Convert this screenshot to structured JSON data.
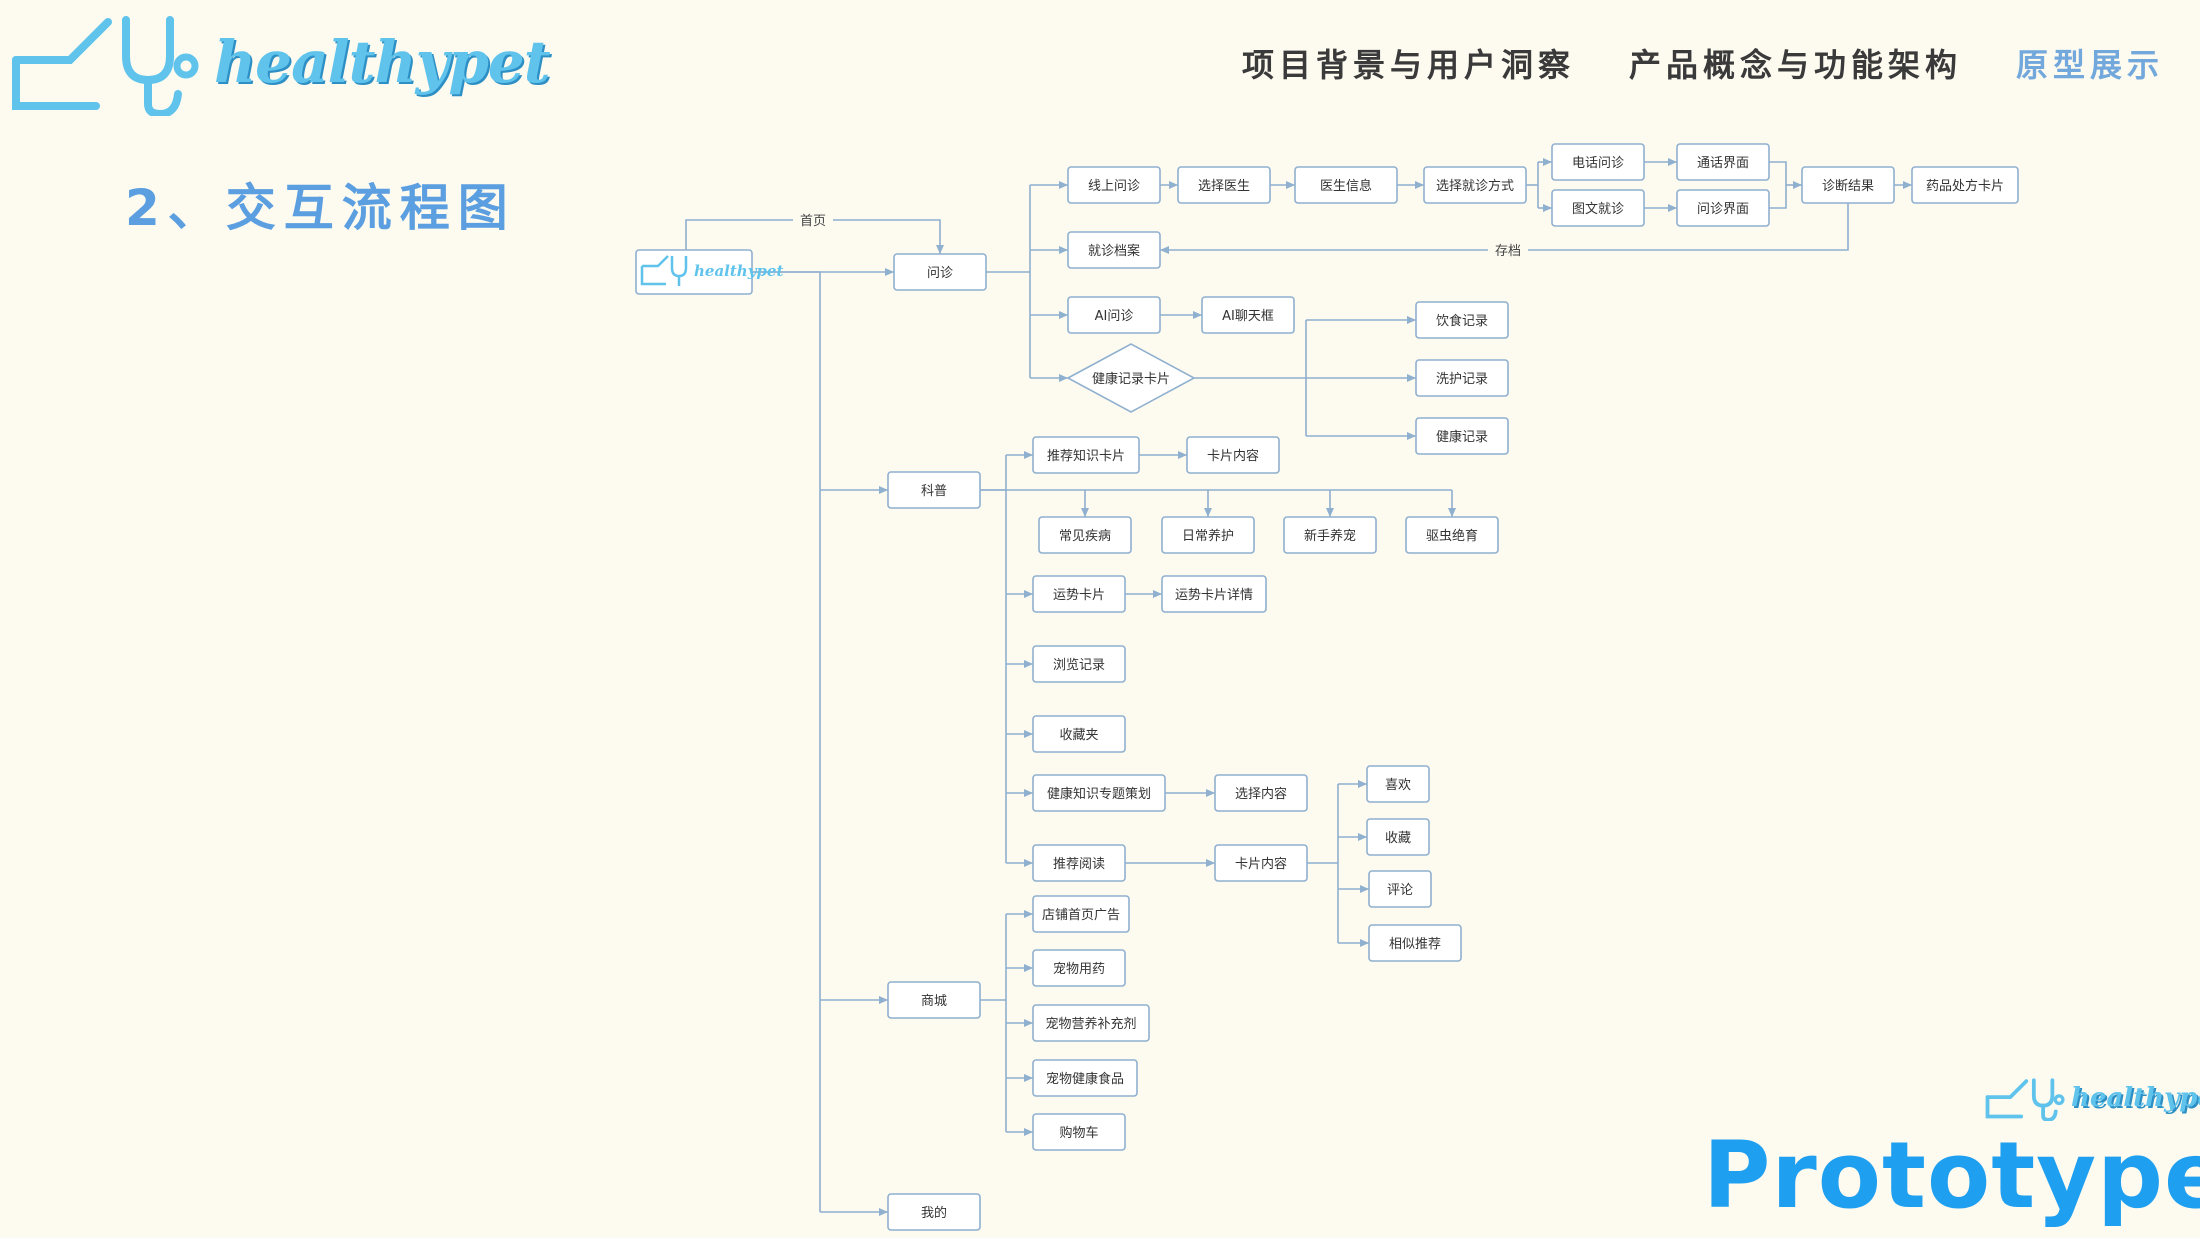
{
  "brand": {
    "name": "healthypet",
    "icon": "stethoscope-icon"
  },
  "nav": {
    "items": [
      "项目背景与用户洞察",
      "产品概念与功能架构",
      "原型展示"
    ],
    "active_index": 2
  },
  "section_title": "2、交互流程图",
  "footer_word": "Prototype",
  "colors": {
    "accent": "#5b9fe0",
    "brand": "#5fc3ec",
    "prototype": "#1f9ff0",
    "line": "#8fb0cf",
    "background": "#fdfaf0"
  },
  "diagram": {
    "nodes": {
      "home": "healthypet",
      "wenzhen": "问诊",
      "kepu": "科普",
      "shangcheng": "商城",
      "wode": "我的",
      "xianshang": "线上问诊",
      "xuanze_ys": "选择医生",
      "ys_xinxi": "医生信息",
      "jiuzhen_fs": "选择就诊方式",
      "dianhua": "电话问诊",
      "tuwen": "图文就诊",
      "tonghua": "通话界面",
      "wenzhen_jm": "问诊界面",
      "zhenduan": "诊断结果",
      "yaopin": "药品处方卡片",
      "dangan": "就诊档案",
      "ai": "AI问诊",
      "ai_chat": "AI聊天框",
      "jiankang_kp": "健康记录卡片",
      "yinshi": "饮食记录",
      "xihu": "洗护记录",
      "jiankang_jl": "健康记录",
      "tuijian_zs": "推荐知识卡片",
      "kp_neirong": "卡片内容",
      "changjian": "常见疾病",
      "richang": "日常养护",
      "xinshou": "新手养宠",
      "quchong": "驱虫绝育",
      "yunshi": "运势卡片",
      "yunshi_xq": "运势卡片详情",
      "liulan": "浏览记录",
      "shoucangjia": "收藏夹",
      "zhuanti": "健康知识专题策划",
      "xuanze_nr": "选择内容",
      "tuijian_yd": "推荐阅读",
      "kp_neirong2": "卡片内容",
      "xihuan": "喜欢",
      "shoucang": "收藏",
      "pinglun": "评论",
      "xiangsi": "相似推荐",
      "dianpu": "店铺首页广告",
      "yongyao": "宠物用药",
      "yingyang": "宠物营养补充剂",
      "shipin": "宠物健康食品",
      "gouwuche": "购物车"
    },
    "edge_labels": {
      "home_loop": "首页",
      "archive": "存档"
    }
  }
}
